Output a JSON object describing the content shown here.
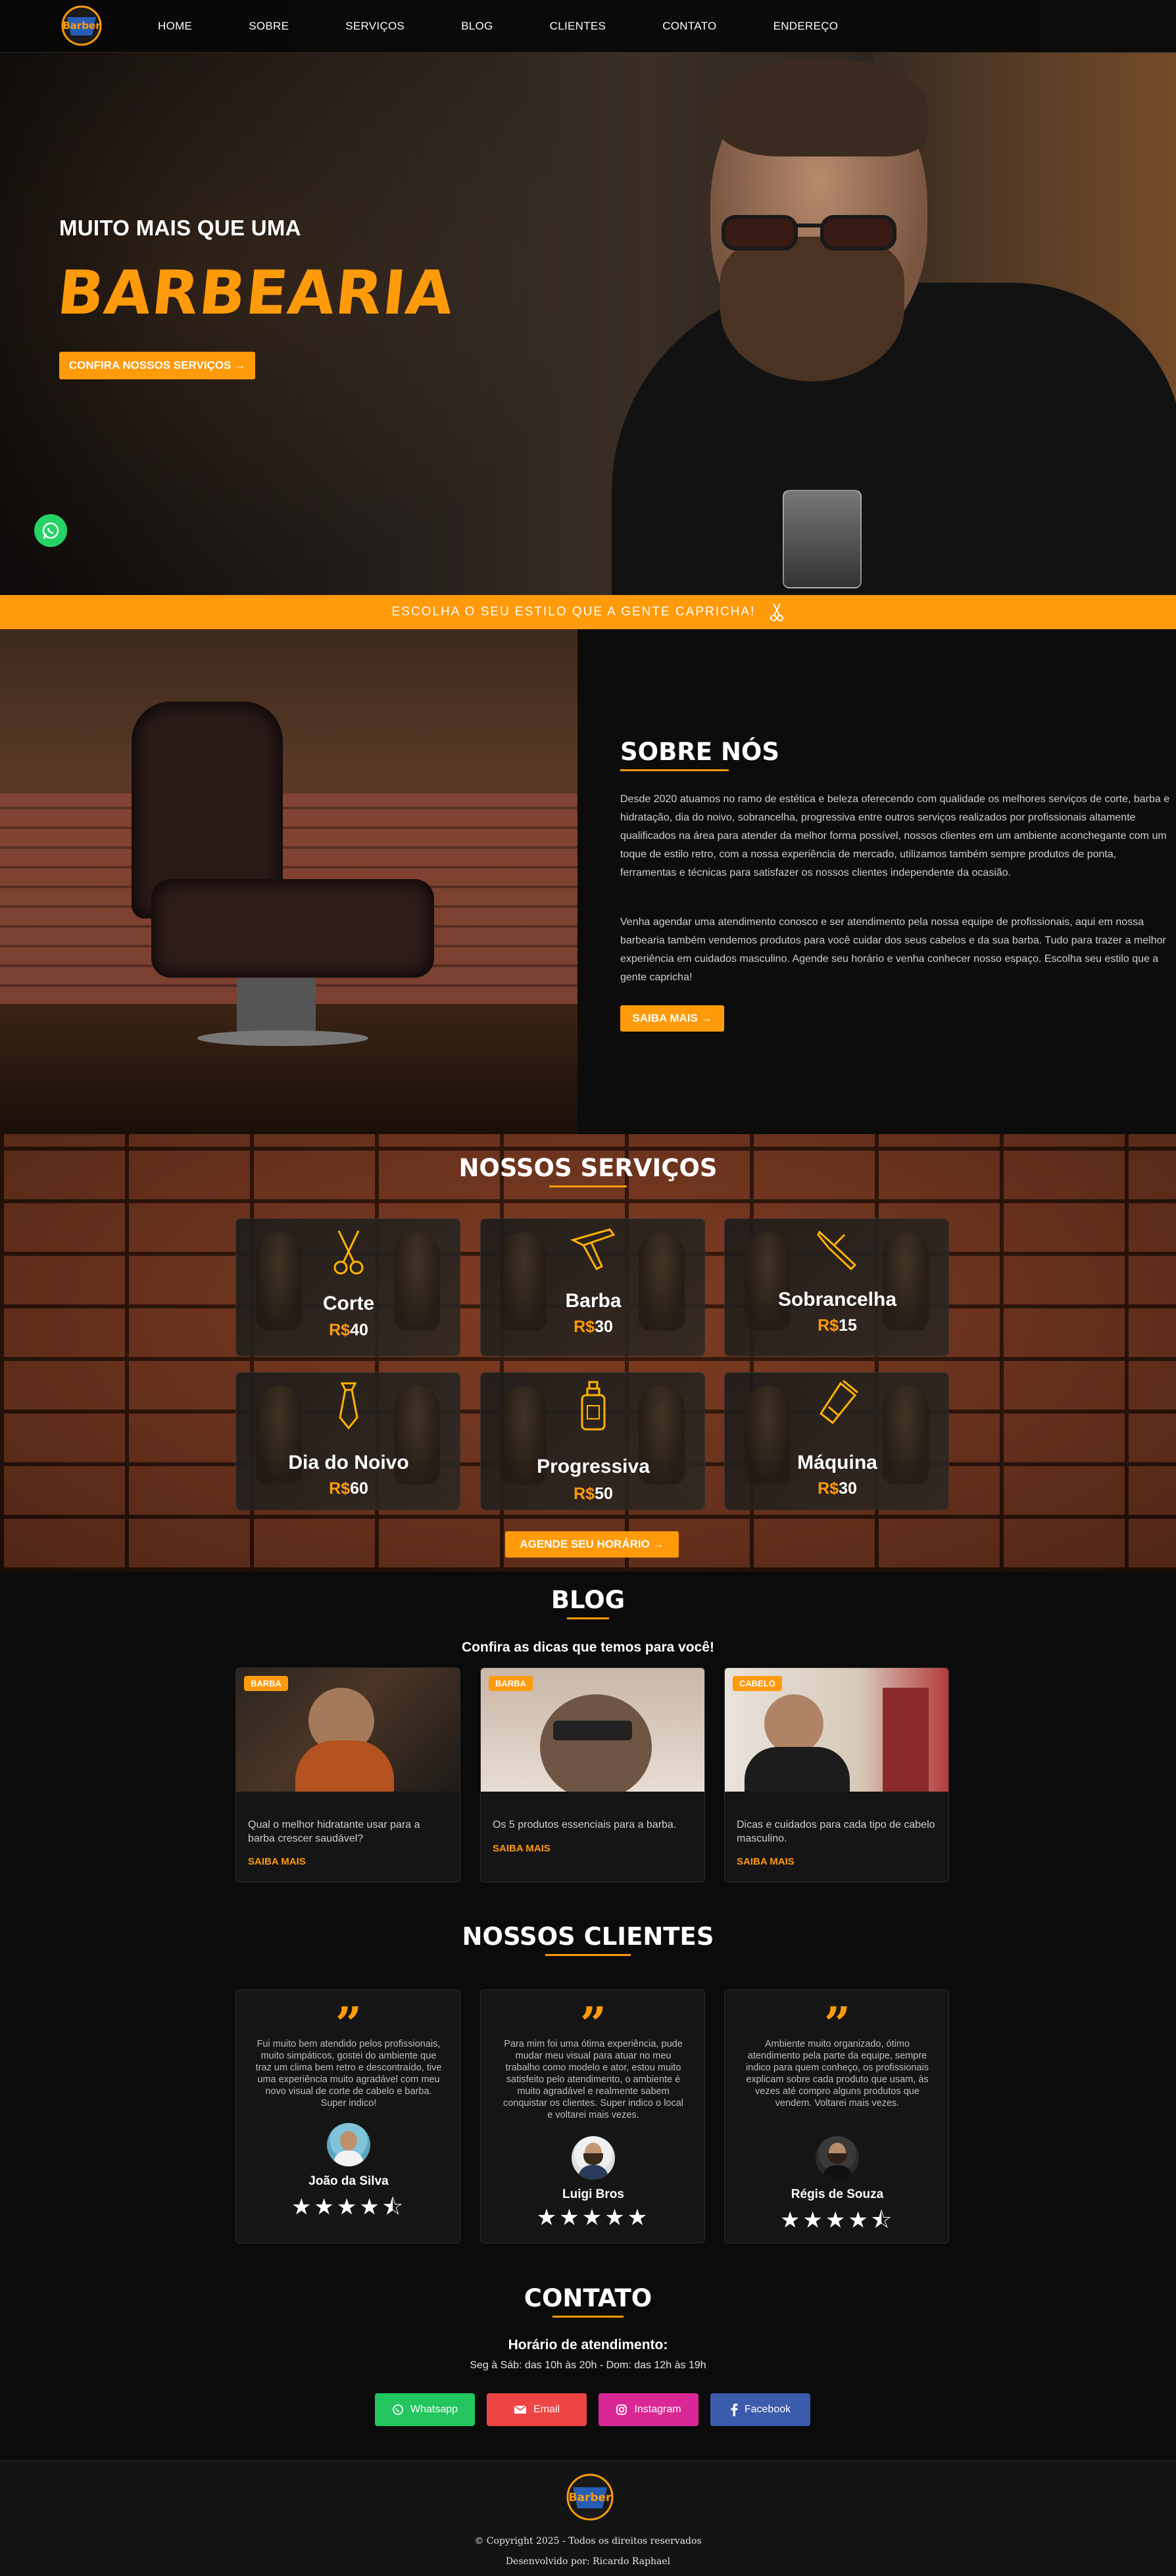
{
  "brand": {
    "logo_text": "Barber"
  },
  "nav": {
    "items": [
      "HOME",
      "SOBRE",
      "SERVIÇOS",
      "BLOG",
      "CLIENTES",
      "CONTATO",
      "ENDEREÇO"
    ]
  },
  "hero": {
    "subtitle": "MUITO MAIS QUE UMA",
    "title": "BARBEARIA",
    "button": "CONFIRA NOSSOS SERVIÇOS →"
  },
  "strip": {
    "text": "ESCOLHA O SEU ESTILO QUE A GENTE CAPRICHA!"
  },
  "about": {
    "title": "SOBRE NÓS",
    "p1": "Desde 2020 atuamos no ramo de estética e beleza oferecendo com qualidade os melhores serviços de corte, barba e hidratação, dia do noivo, sobrancelha, progressiva entre outros serviços realizados por profissionais altamente qualificados na área para atender da melhor forma possível, nossos clientes em um ambiente aconchegante com um toque de estilo retro, com a nossa experiência de mercado, utilizamos também sempre produtos de ponta, ferramentas e técnicas para satisfazer os nossos clientes independente da ocasião.",
    "p2": "Venha agendar uma atendimento conosco e ser atendimento pela nossa equipe de profissionais, aqui em nossa barbearia também vendemos produtos para você cuidar dos seus cabelos e da sua barba. Tudo para trazer a melhor experiência em cuidados masculino. Agende seu horário e venha conhecer nosso espaço. Escolha seu estilo que a gente capricha!",
    "button": "SAIBA MAIS →"
  },
  "services": {
    "title": "NOSSOS SERVIÇOS",
    "currency": "R$",
    "items": [
      {
        "name": "Corte",
        "price": "40",
        "icon": "scissors-icon"
      },
      {
        "name": "Barba",
        "price": "30",
        "icon": "razor-icon"
      },
      {
        "name": "Sobrancelha",
        "price": "15",
        "icon": "eyebrow-razor-icon"
      },
      {
        "name": "Dia do Noivo",
        "price": "60",
        "icon": "tie-icon"
      },
      {
        "name": "Progressiva",
        "price": "50",
        "icon": "bottle-icon"
      },
      {
        "name": "Máquina",
        "price": "30",
        "icon": "clipper-icon"
      }
    ],
    "button": "AGENDE SEU HORÁRIO →"
  },
  "blog": {
    "title": "BLOG",
    "subtitle": "Confira as dicas que temos para você!",
    "link": "SAIBA MAIS",
    "posts": [
      {
        "tag": "BARBA",
        "text": "Qual o melhor hidratante usar para a barba crescer saudável?"
      },
      {
        "tag": "BARBA",
        "text": "Os 5 produtos essenciais para a barba."
      },
      {
        "tag": "CABELO",
        "text": "Dicas e cuidados para cada tipo de cabelo masculino."
      }
    ]
  },
  "clients": {
    "title": "NOSSOS CLIENTES",
    "items": [
      {
        "text": "Fui muito bem atendido pelos profissionais, muito simpáticos, gostei do ambiente que traz um clima bem retro e descontraído, tive uma experiência muito agradável com meu novo visual de corte de cabelo e barba. Super indico!",
        "name": "João da Silva",
        "stars": 4.5
      },
      {
        "text": "Para mim foi uma ótima experiência, pude mudar meu visual para atuar no meu trabalho como modelo e ator, estou muito satisfeito pelo atendimento, o ambiente é muito agradável e realmente sabem conquistar os clientes. Super indico o local e voltarei mais vezes.",
        "name": "Luigi Bros",
        "stars": 5
      },
      {
        "text": "Ambiente muito organizado, ótimo atendimento pela parte da equipe, sempre indico para quem conheço, os profissionais explicam sobre cada produto que usam, às vezes até compro alguns produtos que vendem. Voltarei mais vezes.",
        "name": "Régis de Souza",
        "stars": 4.5
      }
    ]
  },
  "contact": {
    "title": "CONTATO",
    "hours_title": "Horário de atendimento:",
    "hours": "Seg à Sáb: das 10h às 20h - Dom: das 12h às 19h",
    "buttons": [
      {
        "label": "Whatsapp",
        "color": "#22c55e",
        "icon": "whatsapp-icon"
      },
      {
        "label": "Email",
        "color": "#ef4444",
        "icon": "email-icon"
      },
      {
        "label": "Instagram",
        "color": "#db2795",
        "icon": "instagram-icon"
      },
      {
        "label": "Facebook",
        "color": "#3b5bab",
        "icon": "facebook-icon"
      }
    ]
  },
  "footer": {
    "copyright": "© Copyright 2025 - Todos os direitos reservados",
    "developer": "Desenvolvido por: Ricardo Raphael"
  },
  "colors": {
    "accent": "#ff9a0b",
    "background": "#0b0b0b",
    "card": "#151515"
  }
}
